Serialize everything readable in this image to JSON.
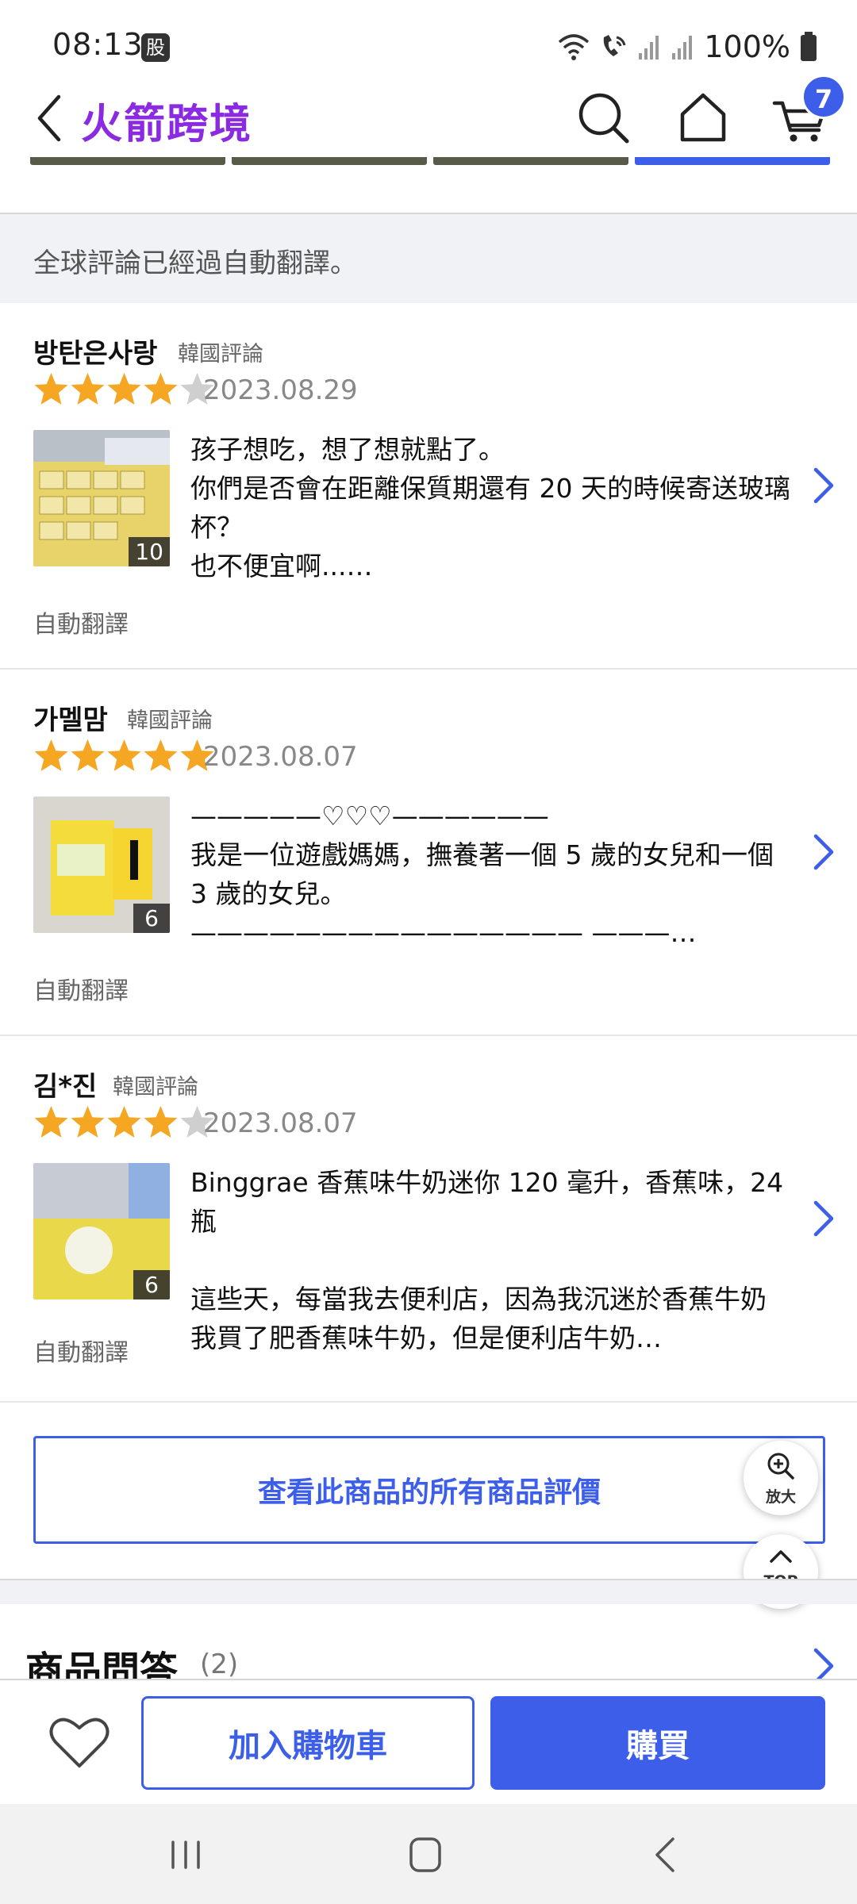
{
  "status_bar": {
    "time": "08:13",
    "badge": "股",
    "battery": "100%"
  },
  "header": {
    "title": "火箭跨境",
    "cart_count": "7"
  },
  "notice": "全球評論已經過自動翻譯。",
  "reviews": [
    {
      "name": "방탄은사랑",
      "origin": "韓國評論",
      "rating": 4,
      "date": "2023.08.29",
      "photo_count": "10",
      "text": "孩子想吃，想了想就點了。\n你們是否會在距離保質期還有 20 天的時候寄送玻璃杯？\n也不便宜啊...…",
      "auto_label": "自動翻譯"
    },
    {
      "name": "가멜맘",
      "origin": "韓國評論",
      "rating": 5,
      "date": "2023.08.07",
      "photo_count": "6",
      "text": "—————♡♡♡——————\n我是一位遊戲媽媽，撫養著一個 5 歲的女兒和一個 3 歲的女兒。\n——————————————— ———…",
      "auto_label": "自動翻譯"
    },
    {
      "name": "김*진",
      "origin": "韓國評論",
      "rating": 4,
      "date": "2023.08.07",
      "photo_count": "6",
      "text": "Binggrae 香蕉味牛奶迷你 120 毫升，香蕉味，24 瓶\n\n這些天，每當我去便利店，因為我沉迷於香蕉牛奶\n我買了肥香蕉味牛奶，但是便利店牛奶…",
      "auto_label": "自動翻譯"
    }
  ],
  "view_all_label": "查看此商品的所有商品評價",
  "zoom_label": "放大",
  "top_label": "TOP",
  "qa": {
    "title": "商品問答",
    "count": "(2)"
  },
  "actions": {
    "add_to_cart": "加入購物車",
    "buy": "購買"
  },
  "colors": {
    "brand_purple": "#8a2be2",
    "accent_blue": "#3d5ee8",
    "star_orange": "#f5a623",
    "star_gray": "#cfcfcf"
  }
}
